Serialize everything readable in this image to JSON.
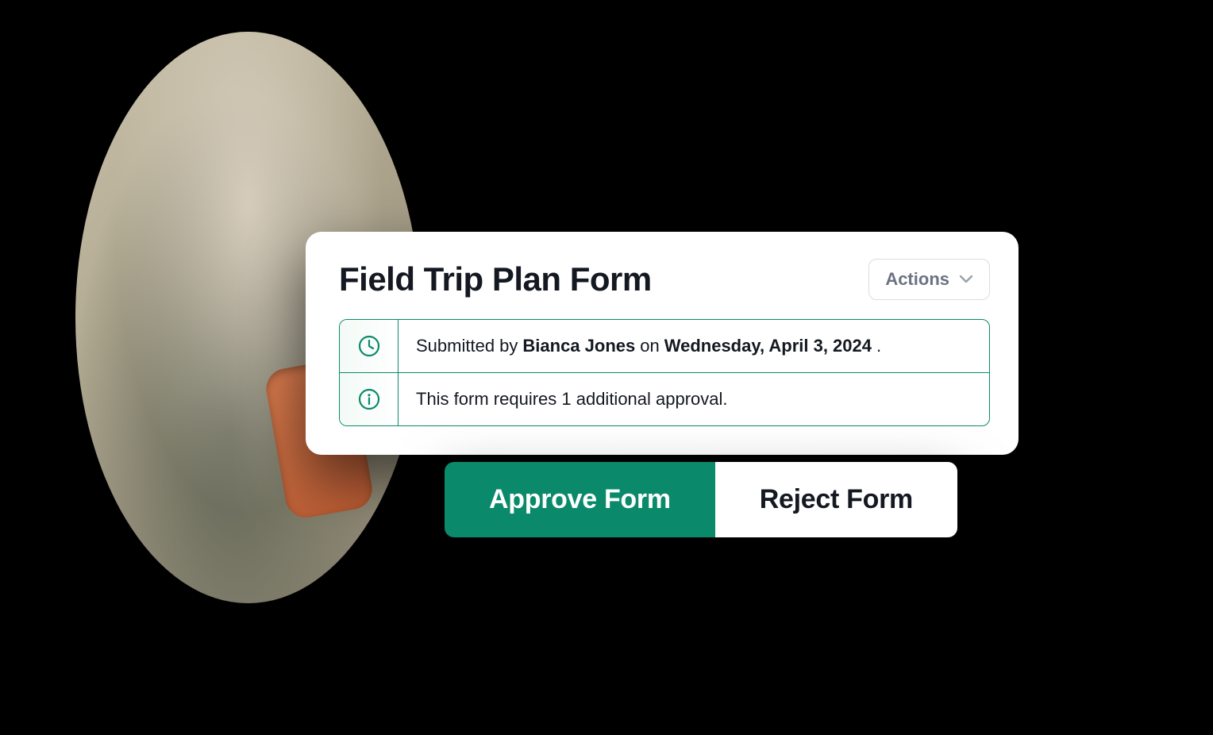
{
  "card": {
    "title": "Field Trip Plan Form",
    "actions_label": "Actions",
    "submitted": {
      "prefix": "Submitted by",
      "submitter": "Bianca Jones",
      "on_word": "on",
      "date": "Wednesday, April 3, 2024",
      "suffix": "."
    },
    "approval_line": "This form requires 1 additional approval."
  },
  "decision": {
    "approve_label": "Approve Form",
    "reject_label": "Reject Form"
  },
  "colors": {
    "accent": "#0a8a6a"
  }
}
